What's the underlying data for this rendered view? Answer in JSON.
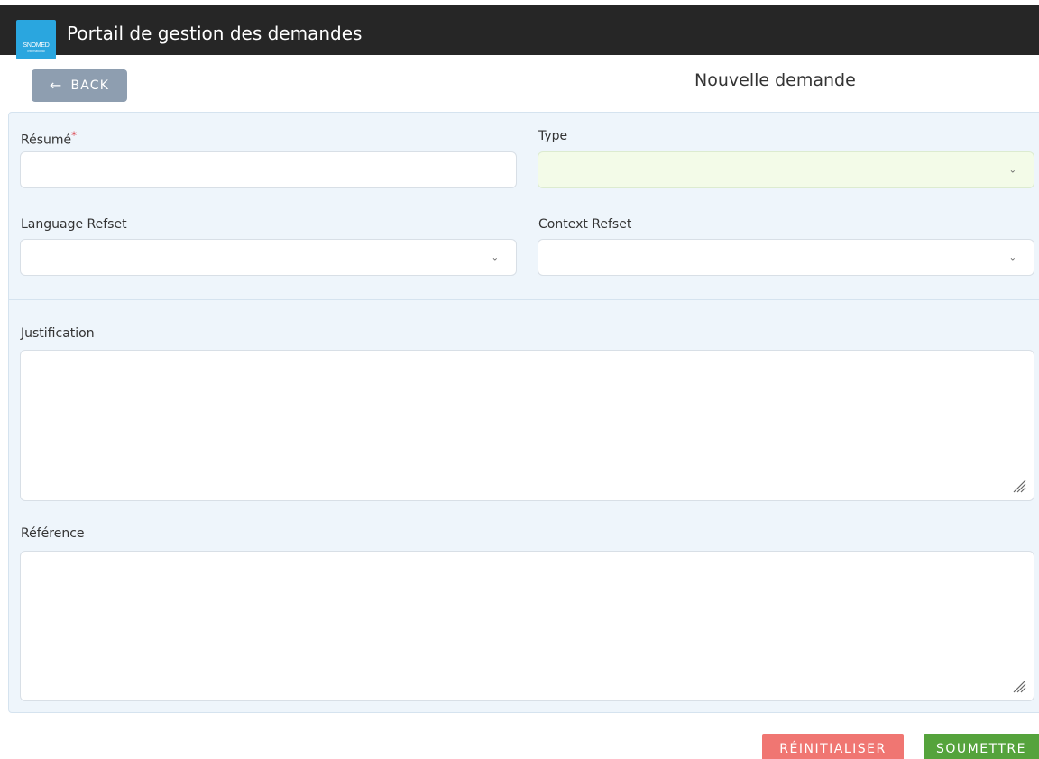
{
  "header": {
    "logo_text": "SNOMED",
    "logo_subtext": "International",
    "title": "Portail de gestion des demandes"
  },
  "nav": {
    "back_icon": "arrow-left-icon",
    "back_label": "BACK"
  },
  "page": {
    "heading": "Nouvelle demande"
  },
  "form": {
    "resume": {
      "label": "Résumé",
      "required_marker": "*",
      "value": ""
    },
    "type": {
      "label": "Type",
      "value": ""
    },
    "language_refset": {
      "label": "Language Refset",
      "value": ""
    },
    "context_refset": {
      "label": "Context Refset",
      "value": ""
    },
    "justification": {
      "label": "Justification",
      "value": ""
    },
    "reference": {
      "label": "Référence",
      "value": ""
    }
  },
  "actions": {
    "reset_label": "RÉINITIALISER",
    "submit_label": "SOUMETTRE"
  },
  "colors": {
    "header_bg": "#262626",
    "panel_bg": "#eef5fb",
    "back_button": "#8e9eb0",
    "reset_button": "#f07672",
    "submit_button": "#55a33c",
    "type_field_bg": "#f3fbe8"
  }
}
